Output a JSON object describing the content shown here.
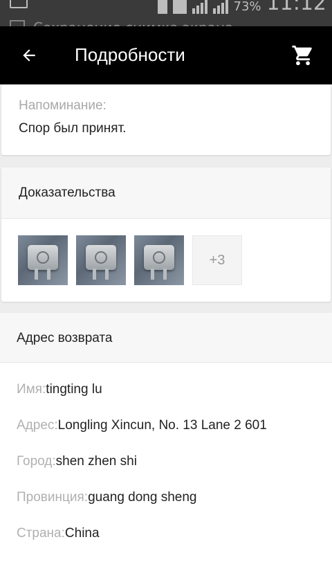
{
  "status_bar": {
    "notification_text": "Сохранение снимка экрана",
    "battery": "73%",
    "time": "11:12"
  },
  "app_bar": {
    "title": "Подробности",
    "back_icon": "arrow-left-icon",
    "cart_icon": "cart-icon"
  },
  "reminder": {
    "label": "Напоминание:",
    "value": "Спор был принят."
  },
  "evidence": {
    "title": "Доказательства",
    "more_label": "+3"
  },
  "return_address": {
    "title": "Адрес возврата",
    "rows": [
      {
        "key": "Имя:",
        "value": "tingting lu"
      },
      {
        "key": "Адрес:",
        "value": "Longling Xincun, No. 13 Lane 2 601"
      },
      {
        "key": "Город:",
        "value": "shen zhen shi"
      },
      {
        "key": "Провинция:",
        "value": "guang dong sheng"
      },
      {
        "key": "Страна:",
        "value": "China"
      }
    ]
  },
  "colors": {
    "app_bar_bg": "#000000",
    "page_bg": "#ededed",
    "label_grey": "#a8a8a8"
  }
}
